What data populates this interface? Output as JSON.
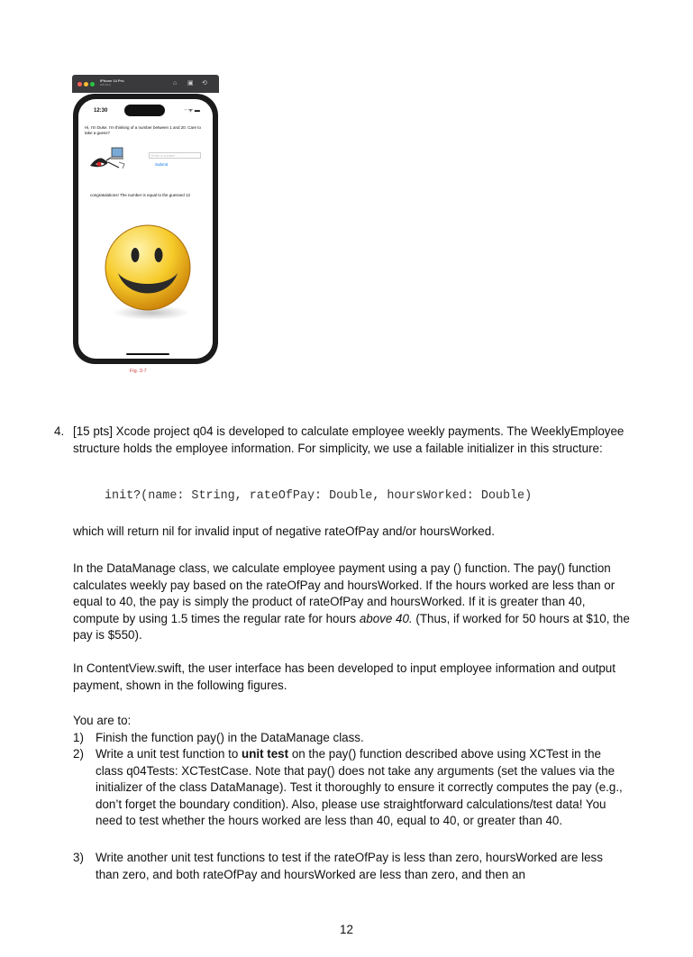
{
  "simulator": {
    "device_name": "iPhone 14 Pro",
    "os_version": "iOS 16.2",
    "time": "12:30",
    "status_icons": "ᐧᐧ ᯤ ▬",
    "intro_text": "Hi, I'm Duke. I'm thinking of a number between 1 and 20. Care to take a guess?",
    "input_placeholder": "Enter a number...",
    "submit_label": "Submit",
    "result_text": "congratulations! The number is equal to the guessed 12",
    "figure_caption": "Fig. 3-7"
  },
  "question": {
    "number": "4.",
    "intro": "[15 pts] Xcode project q04 is developed to calculate employee weekly payments. The WeeklyEmployee structure holds the employee information. For simplicity, we use a failable initializer in this structure:",
    "code": "init?(name: String, rateOfPay: Double, hoursWorked: Double)",
    "nil_note": "which will return nil for invalid input of negative rateOfPay and/or hoursWorked.",
    "datamanage_a": "In the DataManage class, we calculate employee payment using a pay () function. The pay() function calculates weekly pay based on the rateOfPay and hoursWorked. If the hours worked are less than or equal to 40, the pay is simply the product of rateOfPay and hoursWorked. If it is greater than 40, compute by using 1.5 times the regular rate for hours ",
    "datamanage_em": "above 40.",
    "datamanage_b": " (Thus, if worked for 50 hours at $10, the pay is $550).",
    "contentview": "In ContentView.swift, the user interface has been developed to input employee information and output payment, shown in the following figures.",
    "tasks_intro": "You are to:",
    "tasks": [
      {
        "num": "1)",
        "a": "Finish the function pay() in the DataManage class.",
        "bold": "",
        "b": ""
      },
      {
        "num": "2)",
        "a": "Write a unit test function to ",
        "bold": "unit test",
        "b": " on the pay() function described above using XCTest in the class q04Tests: XCTestCase. Note that pay() does not take any arguments (set the values via the initializer of the class DataManage). Test it thoroughly to ensure it correctly computes the pay (e.g., don’t forget the boundary condition). Also, please use straightforward calculations/test data! You need to test whether the hours worked are less than 40, equal to 40, or greater than 40."
      },
      {
        "num": "3)",
        "a": "Write another unit test functions to test if the rateOfPay is less than zero, hoursWorked are less than zero, and both rateOfPay and hoursWorked are less than zero, and then an",
        "bold": "",
        "b": ""
      }
    ]
  },
  "page_number": "12"
}
